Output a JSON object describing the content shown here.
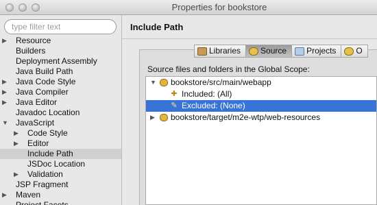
{
  "window": {
    "title": "Properties for bookstore"
  },
  "filter": {
    "placeholder": "type filter text"
  },
  "tree": [
    {
      "label": "Resource",
      "expander": "▶",
      "level": 0
    },
    {
      "label": "Builders",
      "expander": "",
      "level": 0
    },
    {
      "label": "Deployment Assembly",
      "expander": "",
      "level": 0
    },
    {
      "label": "Java Build Path",
      "expander": "",
      "level": 0
    },
    {
      "label": "Java Code Style",
      "expander": "▶",
      "level": 0
    },
    {
      "label": "Java Compiler",
      "expander": "▶",
      "level": 0
    },
    {
      "label": "Java Editor",
      "expander": "▶",
      "level": 0
    },
    {
      "label": "Javadoc Location",
      "expander": "",
      "level": 0
    },
    {
      "label": "JavaScript",
      "expander": "▼",
      "level": 0
    },
    {
      "label": "Code Style",
      "expander": "▶",
      "level": 1
    },
    {
      "label": "Editor",
      "expander": "▶",
      "level": 1
    },
    {
      "label": "Include Path",
      "expander": "",
      "level": 1,
      "selected": true
    },
    {
      "label": "JSDoc Location",
      "expander": "",
      "level": 1
    },
    {
      "label": "Validation",
      "expander": "▶",
      "level": 1
    },
    {
      "label": "JSP Fragment",
      "expander": "",
      "level": 0
    },
    {
      "label": "Maven",
      "expander": "▶",
      "level": 0
    },
    {
      "label": "Project Facets",
      "expander": "",
      "level": 0
    }
  ],
  "page": {
    "title": "Include Path"
  },
  "tabs": [
    {
      "label": "Libraries",
      "icon": "libraries-icon",
      "active": false
    },
    {
      "label": "Source",
      "icon": "source-icon",
      "active": true
    },
    {
      "label": "Projects",
      "icon": "projects-icon",
      "active": false
    },
    {
      "label": "O",
      "icon": "order-icon",
      "active": false
    }
  ],
  "scope_label": "Source files and folders in the Global Scope:",
  "source_list": [
    {
      "label": "bookstore/src/main/webapp",
      "expander": "▼",
      "icon": "source-folder-icon",
      "level": 0
    },
    {
      "label": "Included: (All)",
      "expander": "",
      "icon": "included-icon",
      "level": 1
    },
    {
      "label": "Excluded: (None)",
      "expander": "",
      "icon": "excluded-icon",
      "level": 1,
      "selected": true
    },
    {
      "label": "bookstore/target/m2e-wtp/web-resources",
      "expander": "▶",
      "icon": "source-folder-icon",
      "level": 0
    }
  ],
  "colors": {
    "selection": "#3874d8",
    "tree_selection": "#d0d0d0"
  }
}
